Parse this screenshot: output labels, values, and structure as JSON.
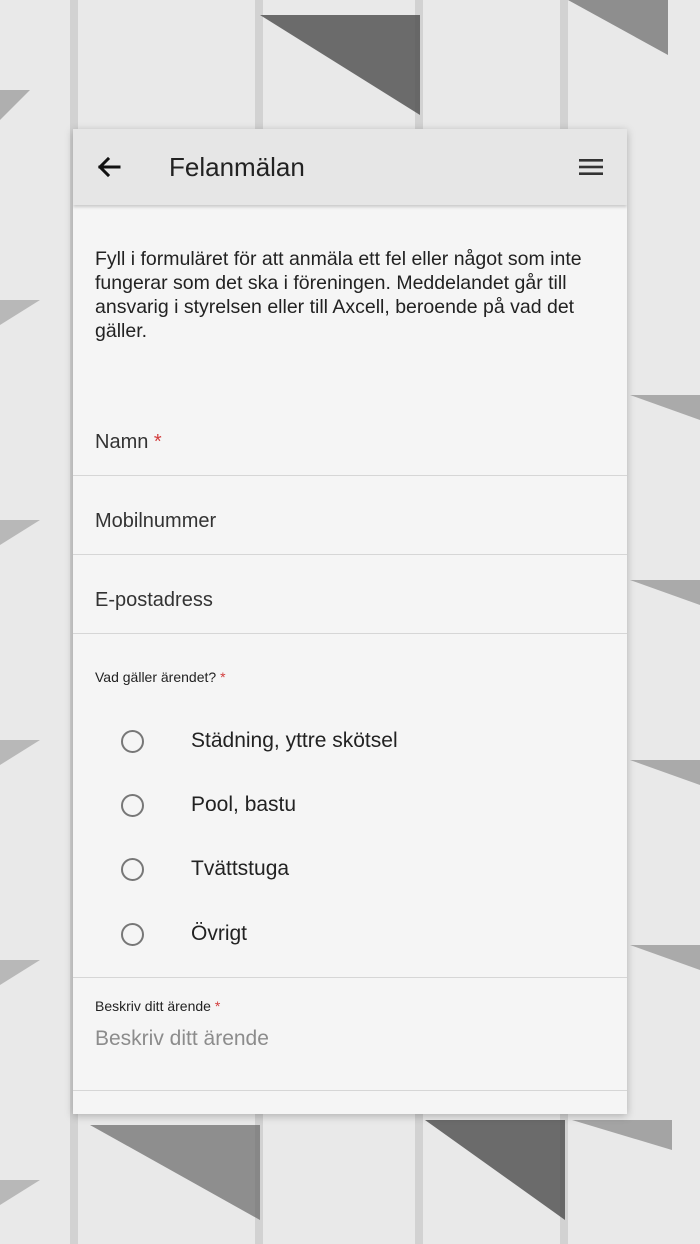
{
  "header": {
    "title": "Felanmälan",
    "back_icon": "arrow-left-icon",
    "menu_icon": "hamburger-menu-icon"
  },
  "intro": {
    "text": "Fyll i formuläret för att anmäla ett fel eller något som inte fungerar som det ska i föreningen. Meddelandet går till ansvarig i styrelsen eller till Axcell, beroende på vad det gäller."
  },
  "form": {
    "name": {
      "label": "Namn",
      "required_mark": "*",
      "value": ""
    },
    "phone": {
      "label": "Mobilnummer",
      "value": ""
    },
    "email": {
      "label": "E-postadress",
      "value": ""
    },
    "category": {
      "label": "Vad gäller ärendet?",
      "required_mark": "*",
      "options": [
        "Städning, yttre skötsel",
        "Pool, bastu",
        "Tvättstuga",
        "Övrigt"
      ],
      "selected": null
    },
    "description": {
      "label": "Beskriv ditt ärende",
      "required_mark": "*",
      "placeholder": "Beskriv ditt ärende",
      "value": ""
    }
  },
  "colors": {
    "required": "#d23c3c",
    "appbar_bg": "#e6e6e6",
    "card_bg": "#f5f5f5"
  }
}
